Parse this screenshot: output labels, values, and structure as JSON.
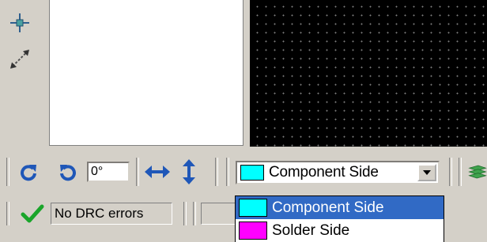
{
  "toolbar": {
    "angle_value": "0°",
    "layer_select": {
      "selected": "Component Side",
      "selected_color": "#00ffff"
    }
  },
  "status": {
    "drc_text": "No DRC errors"
  },
  "layer_dropdown": {
    "options": [
      {
        "label": "Component Side",
        "color": "#00ffff",
        "selected": true
      },
      {
        "label": "Solder Side",
        "color": "#ff00ff",
        "selected": false
      }
    ]
  },
  "colors": {
    "selection": "#316ac5",
    "canvas_bg": "#000000",
    "grid_dot": "#7f7f7f",
    "panel_bg": "#d4d0c8"
  },
  "icons": [
    "crosshair-icon",
    "measure-icon",
    "rotate-cw-icon",
    "rotate-ccw-icon",
    "flip-horizontal-icon",
    "flip-vertical-icon",
    "check-icon",
    "layers-icon",
    "chevron-down-icon"
  ]
}
